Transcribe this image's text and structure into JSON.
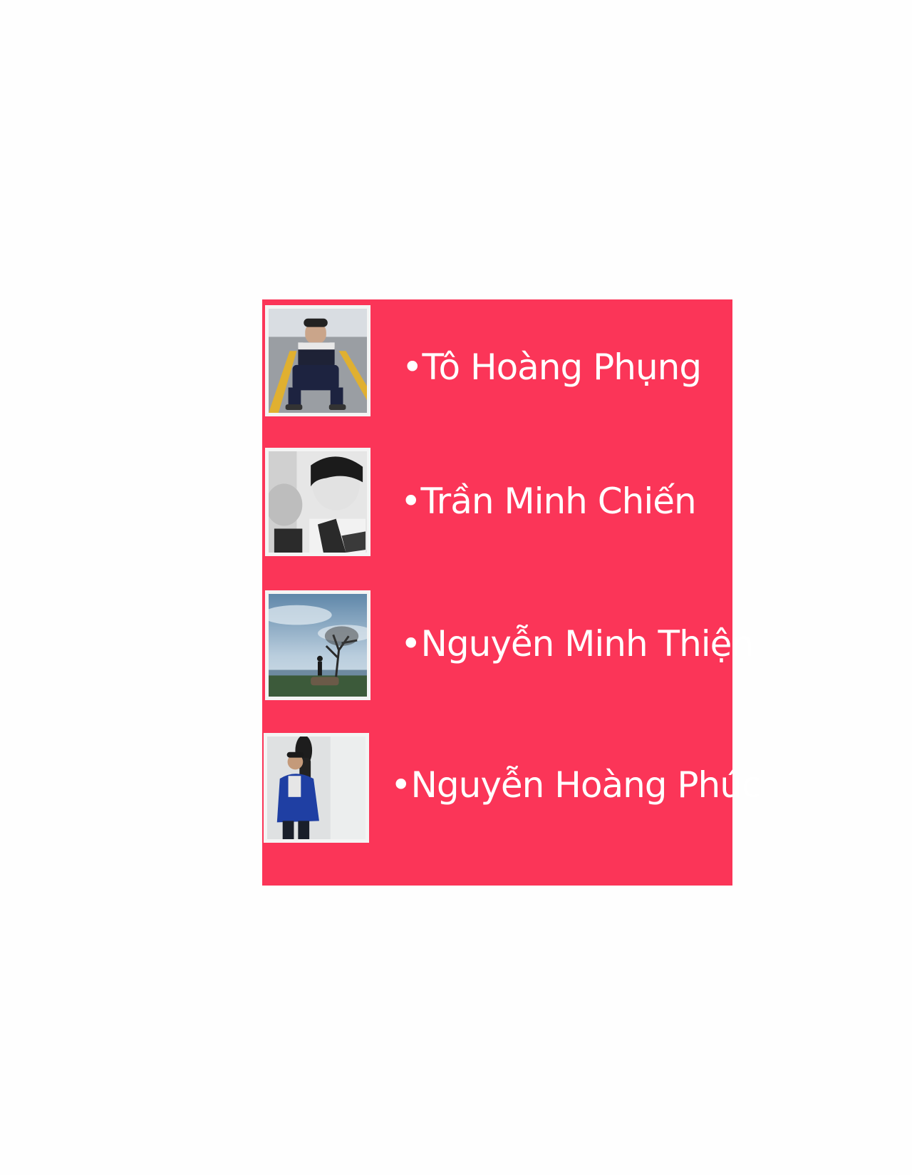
{
  "panel_color": "#fb3558",
  "members": [
    {
      "name": "•Tô Hoàng Phụng",
      "photo": "person-sitting-on-road-photo"
    },
    {
      "name": "•Trần Minh Chiến",
      "photo": "grayscale-selfie-photo"
    },
    {
      "name": "•Nguyễn Minh Thiện",
      "photo": "person-on-hilltop-with-tree-photo"
    },
    {
      "name": "•Nguyễn Hoàng Phúc",
      "photo": "person-in-blue-jacket-with-guitar-photo"
    }
  ]
}
